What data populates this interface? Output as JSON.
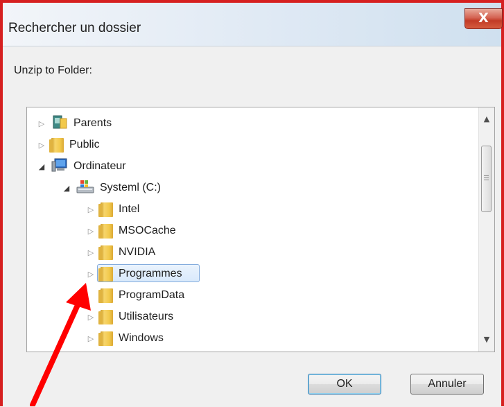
{
  "dialog": {
    "title": "Rechercher un dossier",
    "close_glyph": "X",
    "prompt": "Unzip to Folder:",
    "ok_label": "OK",
    "cancel_label": "Annuler"
  },
  "tree": {
    "rows": [
      {
        "label": "Parents",
        "icon": "user-folder-icon",
        "expander": "collapsed"
      },
      {
        "label": "Public",
        "icon": "folder-icon",
        "expander": "collapsed"
      },
      {
        "label": "Ordinateur",
        "icon": "computer-icon",
        "expander": "expanded"
      },
      {
        "label": "Systeml (C:)",
        "icon": "drive-icon",
        "expander": "expanded"
      },
      {
        "label": "Intel",
        "icon": "folder-icon",
        "expander": "collapsed"
      },
      {
        "label": "MSOCache",
        "icon": "folder-icon",
        "expander": "collapsed"
      },
      {
        "label": "NVIDIA",
        "icon": "folder-icon",
        "expander": "collapsed"
      },
      {
        "label": "Programmes",
        "icon": "folder-icon",
        "expander": "collapsed",
        "selected": true
      },
      {
        "label": "ProgramData",
        "icon": "folder-icon",
        "expander": "collapsed"
      },
      {
        "label": "Utilisateurs",
        "icon": "folder-icon",
        "expander": "collapsed"
      },
      {
        "label": "Windows",
        "icon": "folder-icon",
        "expander": "collapsed"
      }
    ]
  },
  "colors": {
    "frame": "#d62020",
    "annotation_arrow": "#ff0000",
    "selection_border": "#84acdd",
    "close_button": "#c23b26"
  }
}
